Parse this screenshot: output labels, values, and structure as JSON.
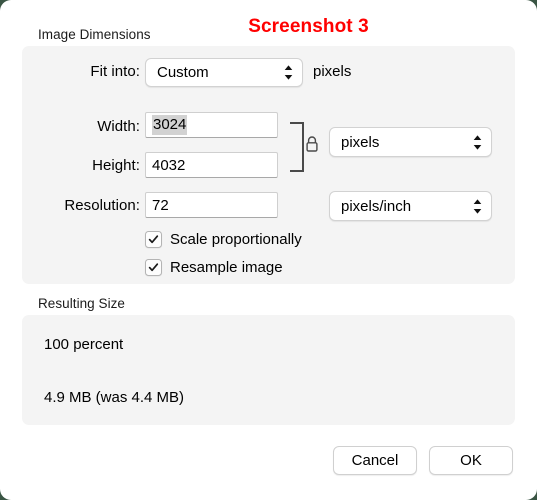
{
  "annotation": {
    "text": "Screenshot 3",
    "color": "#ff0000"
  },
  "dialog": {
    "sections": {
      "image_dimensions": {
        "label": "Image Dimensions",
        "fit_into": {
          "label": "Fit into:",
          "selected_option": "Custom",
          "suffix": "pixels"
        },
        "width": {
          "label": "Width:",
          "value": "3024",
          "selected": true
        },
        "height": {
          "label": "Height:",
          "value": "4032"
        },
        "dimension_unit": {
          "selected_option": "pixels"
        },
        "resolution": {
          "label": "Resolution:",
          "value": "72"
        },
        "resolution_unit": {
          "selected_option": "pixels/inch"
        },
        "lock_state": "locked",
        "checkboxes": [
          {
            "label": "Scale proportionally",
            "checked": true
          },
          {
            "label": "Resample image",
            "checked": true
          }
        ]
      },
      "resulting_size": {
        "label": "Resulting Size",
        "percent_line": "100 percent",
        "filesize_line": "4.9 MB (was 4.4 MB)"
      }
    },
    "buttons": {
      "cancel": "Cancel",
      "ok": "OK"
    }
  }
}
